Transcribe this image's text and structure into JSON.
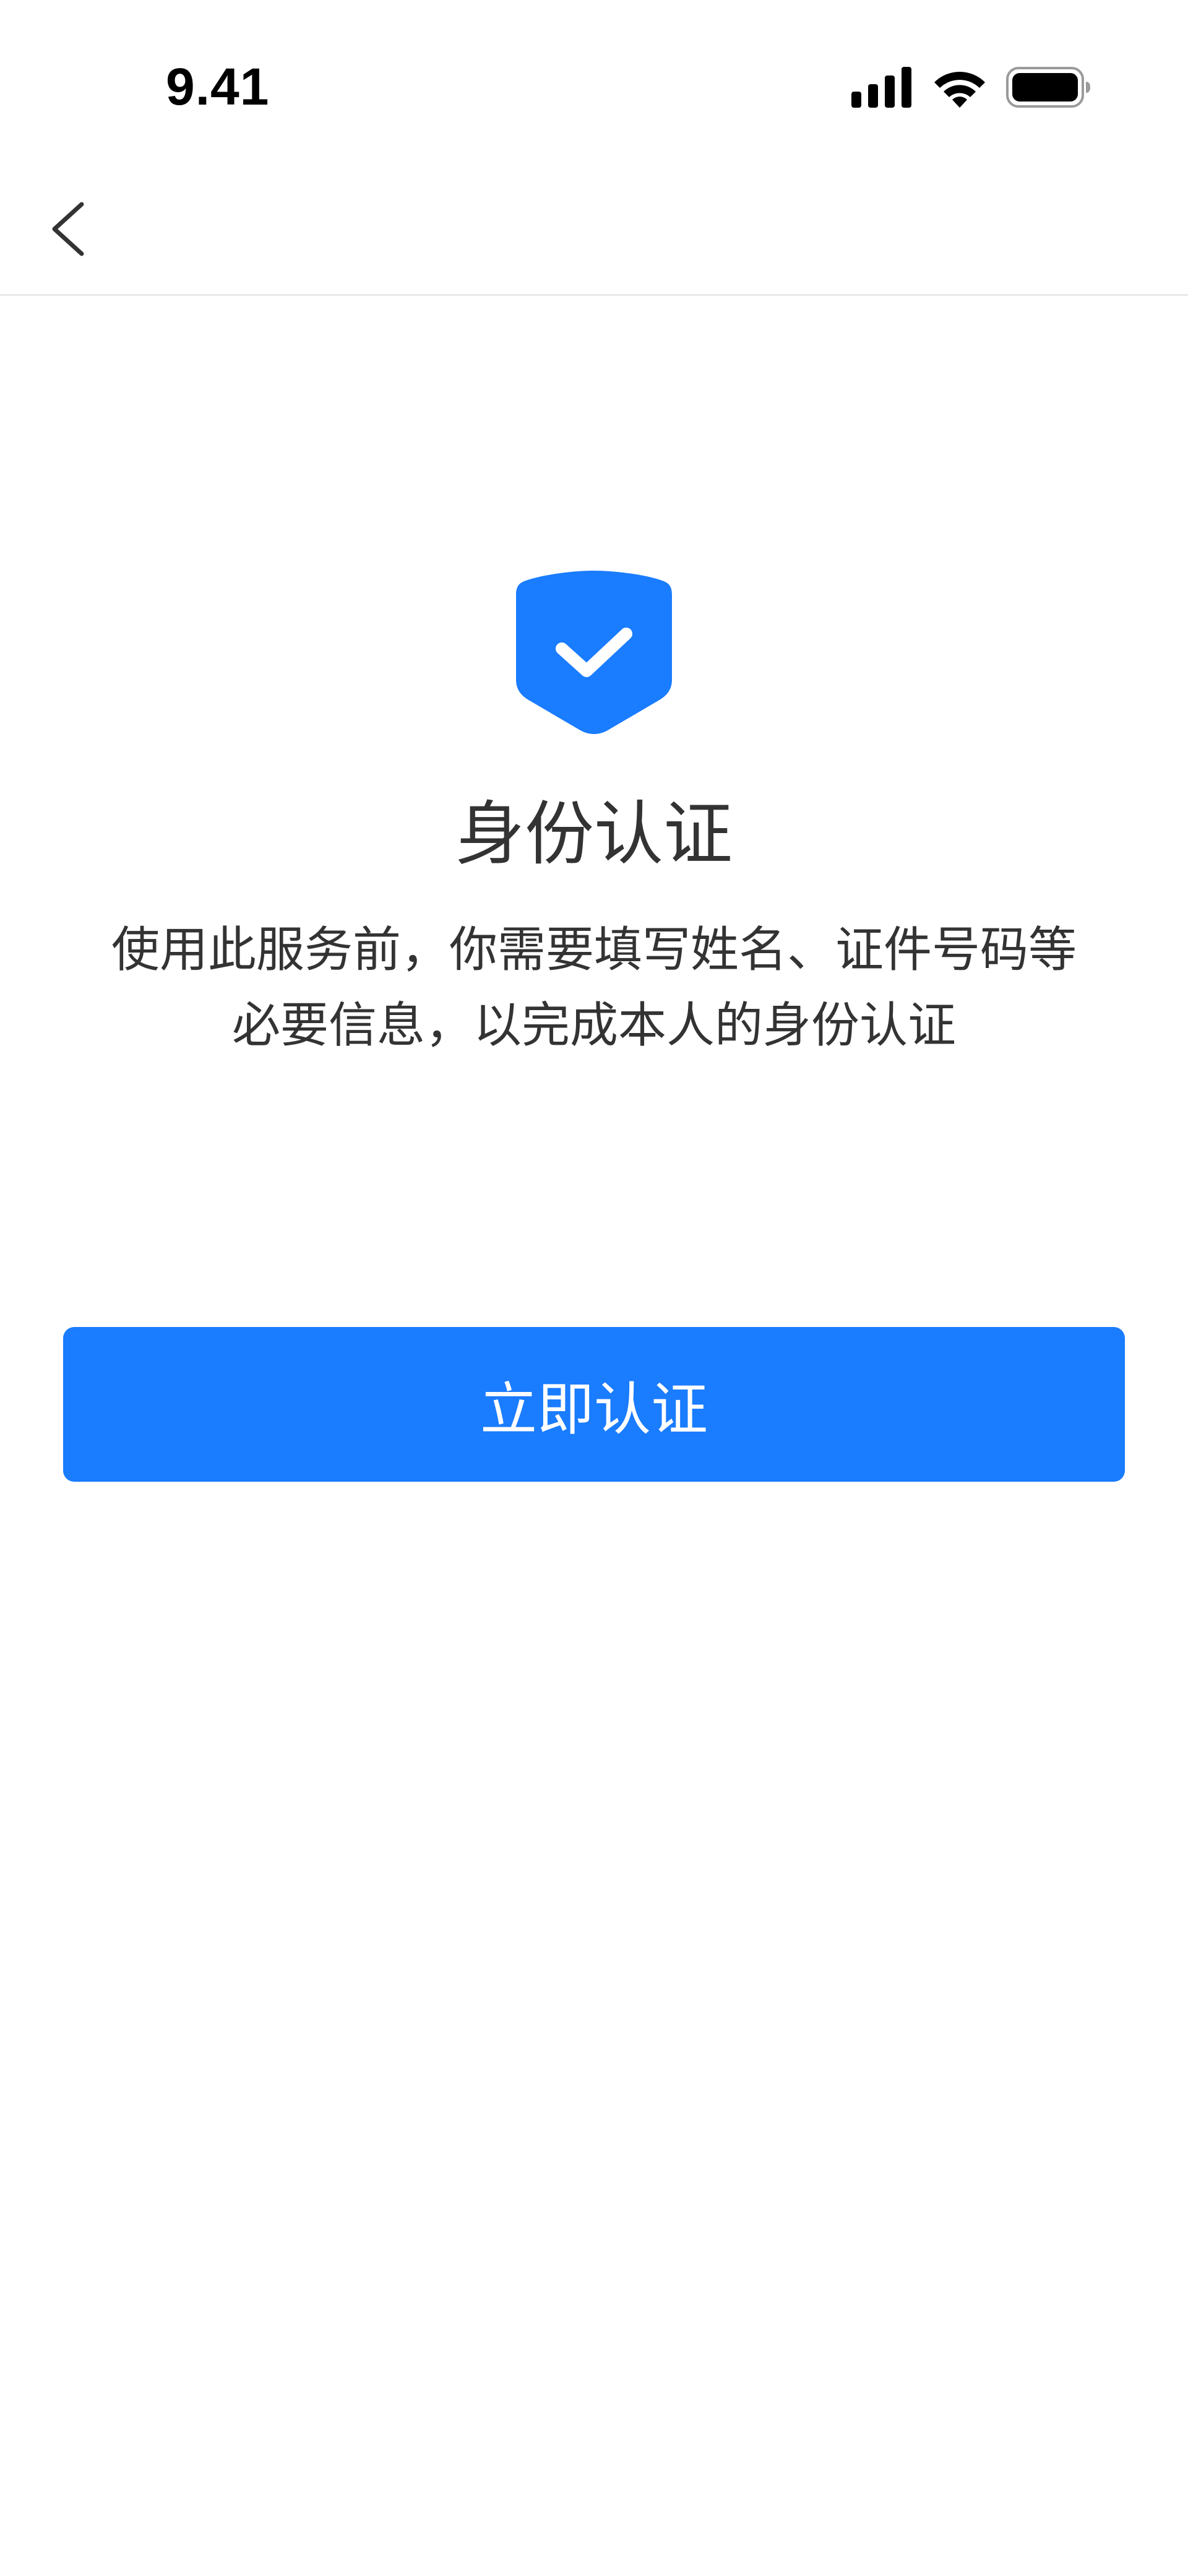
{
  "status_bar": {
    "time": "9.41",
    "icons": [
      "signal-icon",
      "wifi-icon",
      "battery-icon"
    ]
  },
  "nav": {
    "back_icon": "chevron-left-icon"
  },
  "main": {
    "icon": "shield-check-icon",
    "title": "身份认证",
    "description_lines": [
      "使用此服务前，你需要填写姓名、证件号码等",
      "必要信息，以完成本人的身份认证"
    ],
    "verify_button_label": "立即认证"
  },
  "colors": {
    "accent": "#1a7cff",
    "text_primary": "#333333",
    "divider": "#e9e9e9",
    "background": "#ffffff"
  }
}
